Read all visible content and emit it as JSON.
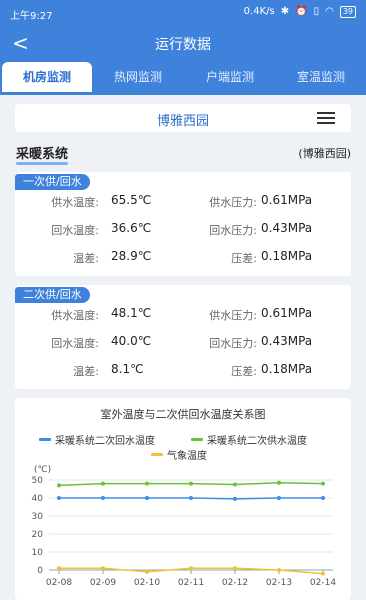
{
  "status_bar": {
    "time": "上午9:27",
    "network_speed": "0.4K/s",
    "battery": "39",
    "icons": [
      "bluetooth-icon",
      "alarm-icon",
      "vibrate-icon",
      "wifi-icon",
      "battery-icon"
    ]
  },
  "nav": {
    "title": "运行数据",
    "back_icon": "back-arrow-icon"
  },
  "tabs": [
    {
      "label": "机房监测",
      "active": true
    },
    {
      "label": "热网监测",
      "active": false
    },
    {
      "label": "户端监测",
      "active": false
    },
    {
      "label": "室温监测",
      "active": false
    }
  ],
  "station": {
    "name": "博雅西园",
    "menu_icon": "hamburger-menu-icon"
  },
  "section": {
    "title": "采暖系统",
    "location": "(博雅西园)"
  },
  "primary": {
    "tag": "一次供/回水",
    "supply_temp_label": "供水温度:",
    "supply_temp": "65.5℃",
    "supply_pressure_label": "供水压力:",
    "supply_pressure": "0.61MPa",
    "return_temp_label": "回水温度:",
    "return_temp": "36.6℃",
    "return_pressure_label": "回水压力:",
    "return_pressure": "0.43MPa",
    "temp_diff_label": "温差:",
    "temp_diff": "28.9℃",
    "pressure_diff_label": "压差:",
    "pressure_diff": "0.18MPa"
  },
  "secondary": {
    "tag": "二次供/回水",
    "supply_temp_label": "供水温度:",
    "supply_temp": "48.1℃",
    "supply_pressure_label": "供水压力:",
    "supply_pressure": "0.61MPa",
    "return_temp_label": "回水温度:",
    "return_temp": "40.0℃",
    "return_pressure_label": "回水压力:",
    "return_pressure": "0.43MPa",
    "temp_diff_label": "温差:",
    "temp_diff": "8.1℃",
    "pressure_diff_label": "压差:",
    "pressure_diff": "0.18MPa"
  },
  "chart_data": {
    "type": "line",
    "title": "室外温度与二次供回水温度关系图",
    "ylabel": "(℃)",
    "xlabel": "",
    "categories": [
      "02-08",
      "02-09",
      "02-10",
      "02-11",
      "02-12",
      "02-13",
      "02-14"
    ],
    "ylim": [
      0,
      50
    ],
    "yticks": [
      0,
      10,
      20,
      30,
      40,
      50
    ],
    "grid": true,
    "legend_position": "top",
    "series": [
      {
        "name": "采暖系统二次回水温度",
        "color": "#3a8ee6",
        "values": [
          40,
          40,
          40,
          40,
          39.5,
          40,
          40
        ]
      },
      {
        "name": "采暖系统二次供水温度",
        "color": "#67c23a",
        "values": [
          47,
          48,
          48,
          48,
          47.5,
          48.5,
          48
        ]
      },
      {
        "name": "气象温度",
        "color": "#f2c037",
        "values": [
          1,
          1,
          -1,
          1,
          1,
          0,
          -2
        ]
      }
    ]
  }
}
